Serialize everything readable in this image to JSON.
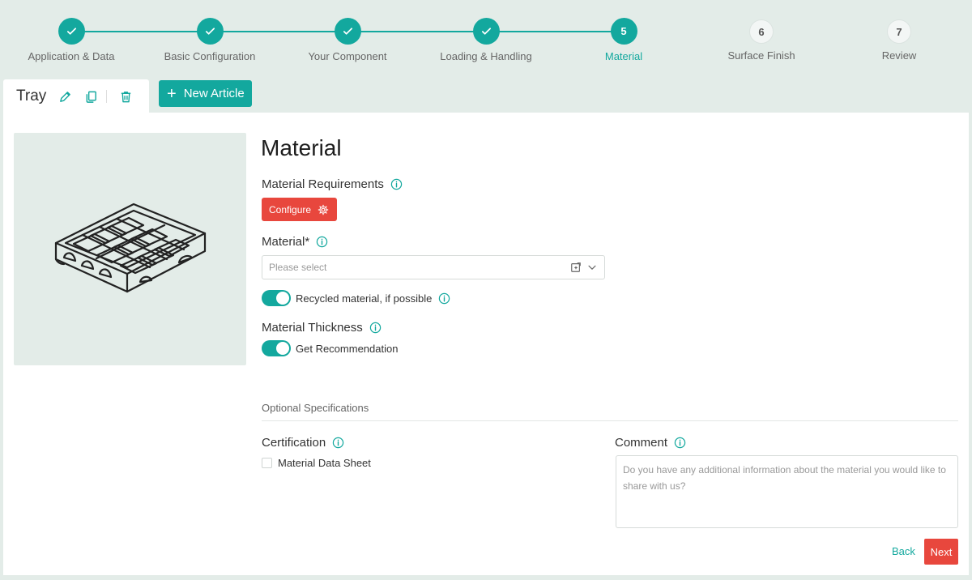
{
  "stepper": {
    "steps": [
      {
        "number": "",
        "label": "Application & Data",
        "state": "done"
      },
      {
        "number": "",
        "label": "Basic Configuration",
        "state": "done"
      },
      {
        "number": "",
        "label": "Your Component",
        "state": "done"
      },
      {
        "number": "",
        "label": "Loading & Handling",
        "state": "done"
      },
      {
        "number": "5",
        "label": "Material",
        "state": "active"
      },
      {
        "number": "6",
        "label": "Surface Finish",
        "state": "todo"
      },
      {
        "number": "7",
        "label": "Review",
        "state": "todo"
      }
    ]
  },
  "tabs": {
    "current": "Tray",
    "new_article_label": "New Article"
  },
  "form": {
    "title": "Material",
    "requirements_label": "Material Requirements",
    "configure_label": "Configure",
    "material_label": "Material*",
    "material_placeholder": "Please select",
    "recycled_label": "Recycled material, if possible",
    "recycled_on": true,
    "thickness_label": "Material Thickness",
    "recommendation_label": "Get Recommendation",
    "recommendation_on": true,
    "optional_title": "Optional Specifications",
    "certification_label": "Certification",
    "data_sheet_label": "Material Data Sheet",
    "data_sheet_checked": false,
    "comment_label": "Comment",
    "comment_placeholder": "Do you have any additional information about the material you would like to share with us?"
  },
  "nav": {
    "back_label": "Back",
    "next_label": "Next"
  },
  "colors": {
    "accent": "#13a89e",
    "danger": "#e8473d",
    "background": "#e3ece8"
  }
}
